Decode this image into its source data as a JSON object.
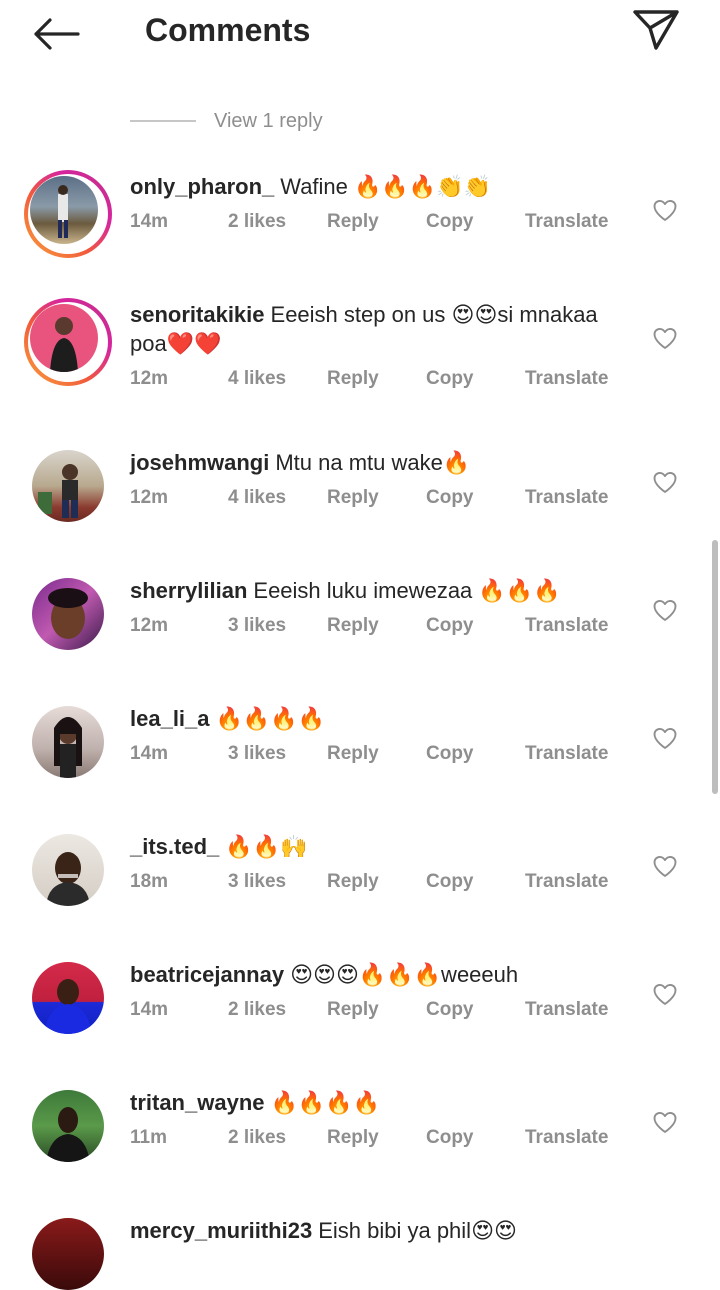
{
  "header": {
    "title": "Comments"
  },
  "view_reply": "View 1 reply",
  "comments": [
    {
      "user": "only_pharon_",
      "text": "Wafine 🔥🔥🔥👏👏",
      "time": "14m",
      "likes": "2 likes",
      "reply": "Reply",
      "copy": "Copy",
      "translate": "Translate"
    },
    {
      "user": "senoritakikie",
      "text": "Eeeish step on us 😍😍si mnakaa poa❤️❤️",
      "time": "12m",
      "likes": "4 likes",
      "reply": "Reply",
      "copy": "Copy",
      "translate": "Translate"
    },
    {
      "user": "josehmwangi",
      "text": "Mtu na mtu wake🔥",
      "time": "12m",
      "likes": "4 likes",
      "reply": "Reply",
      "copy": "Copy",
      "translate": "Translate"
    },
    {
      "user": "sherrylilian",
      "text": "Eeeish luku imewezaa 🔥🔥🔥",
      "time": "12m",
      "likes": "3 likes",
      "reply": "Reply",
      "copy": "Copy",
      "translate": "Translate"
    },
    {
      "user": "lea_li_a",
      "text": "🔥🔥🔥🔥",
      "time": "14m",
      "likes": "3 likes",
      "reply": "Reply",
      "copy": "Copy",
      "translate": "Translate"
    },
    {
      "user": "_its.ted_",
      "text": "🔥🔥🙌",
      "time": "18m",
      "likes": "3 likes",
      "reply": "Reply",
      "copy": "Copy",
      "translate": "Translate"
    },
    {
      "user": "beatricejannay",
      "text": "😍😍😍🔥🔥🔥weeeuh",
      "time": "14m",
      "likes": "2 likes",
      "reply": "Reply",
      "copy": "Copy",
      "translate": "Translate"
    },
    {
      "user": "tritan_wayne",
      "text": "🔥🔥🔥🔥",
      "time": "11m",
      "likes": "2 likes",
      "reply": "Reply",
      "copy": "Copy",
      "translate": "Translate"
    },
    {
      "user": "mercy_muriithi23",
      "text": "Eish bibi ya phil😍😍"
    }
  ],
  "icons": {
    "back": "arrow-left-icon",
    "send": "paper-plane-icon",
    "like": "heart-outline-icon"
  }
}
